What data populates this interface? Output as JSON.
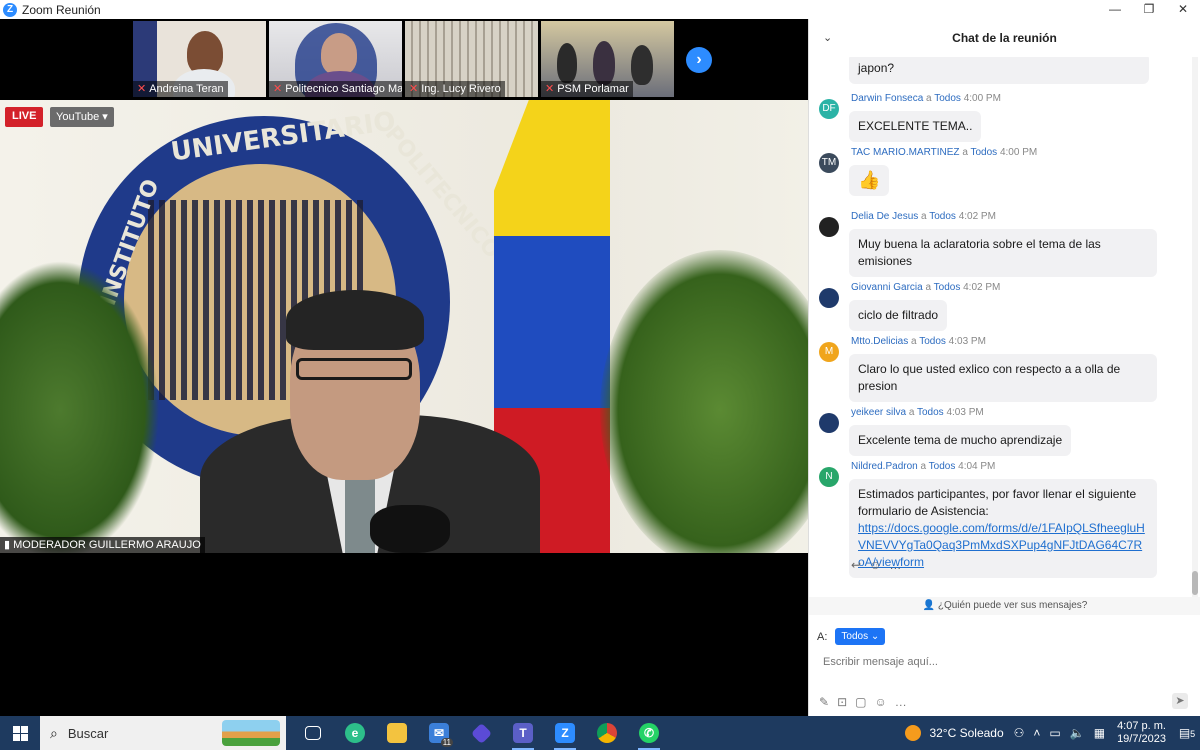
{
  "window": {
    "title": "Zoom Reunión",
    "controls": [
      "—",
      "❐",
      "✕"
    ]
  },
  "participants": [
    {
      "name": "Andreina Teran"
    },
    {
      "name": "Politecnico Santiago Ma..."
    },
    {
      "name": "Ing. Lucy Rivero"
    },
    {
      "name": "PSM Porlamar"
    }
  ],
  "video": {
    "live_label": "LIVE",
    "youtube_label": "YouTube ▾",
    "speaker": "MODERADOR GUILLERMO ARAUJO",
    "emblem_text": "INSTITUTO UNIVERSITARIO POLITECNICO SANTIAGO"
  },
  "chat": {
    "title": "Chat de la reunión",
    "partial_text": "japon?",
    "messages": [
      {
        "initials": "DF",
        "avatar_color": "#2bb3a6",
        "name": "Darwin Fonseca",
        "to": "Todos",
        "time": "4:00 PM",
        "text": "EXCELENTE TEMA.."
      },
      {
        "initials": "TM",
        "avatar_color": "#3b4a5c",
        "name": "TAC MARIO.MARTINEZ",
        "to": "Todos",
        "time": "4:00 PM",
        "text": "👍"
      },
      {
        "initials": "",
        "avatar_color": "#222222",
        "name": "Delia De Jesus",
        "to": "Todos",
        "time": "4:02 PM",
        "text": "Muy buena la aclaratoria sobre el tema de las emisiones"
      },
      {
        "initials": "",
        "avatar_color": "#1f3a6b",
        "name": "Giovanni Garcia",
        "to": "Todos",
        "time": "4:02 PM",
        "text": "ciclo de filtrado"
      },
      {
        "initials": "M",
        "avatar_color": "#f0a51c",
        "name": "Mtto.Delicias",
        "to": "Todos",
        "time": "4:03 PM",
        "text": "Claro lo que usted exlico con respecto a a olla de presion"
      },
      {
        "initials": "",
        "avatar_color": "#1f3a6b",
        "name": "yeikeer silva",
        "to": "Todos",
        "time": "4:03 PM",
        "text": "Excelente tema de mucho aprendizaje"
      },
      {
        "initials": "N",
        "avatar_color": "#28a66a",
        "name": "Nildred.Padron",
        "to": "Todos",
        "time": "4:04 PM",
        "text": "Estimados participantes, por  favor llenar el siguiente formulario de Asistencia:",
        "link": "https://docs.google.com/forms/d/e/1FAIpQLSfheegluHVNEVVYgTa0Qaq3PmMxdSXPup4gNFJtDAG64C7RoA/viewform"
      }
    ],
    "recipient_connector": "a",
    "who_can_see": "¿Quién puede ver sus mensajes?",
    "to_label": "A:",
    "to_value": "Todos",
    "composer_placeholder": "Escribir mensaje aquí..."
  },
  "taskbar": {
    "search_label": "Buscar",
    "weather": "32°C  Soleado",
    "time": "4:07 p. m.",
    "date": "19/7/2023",
    "mail_badge": "11",
    "notifications": "5"
  }
}
